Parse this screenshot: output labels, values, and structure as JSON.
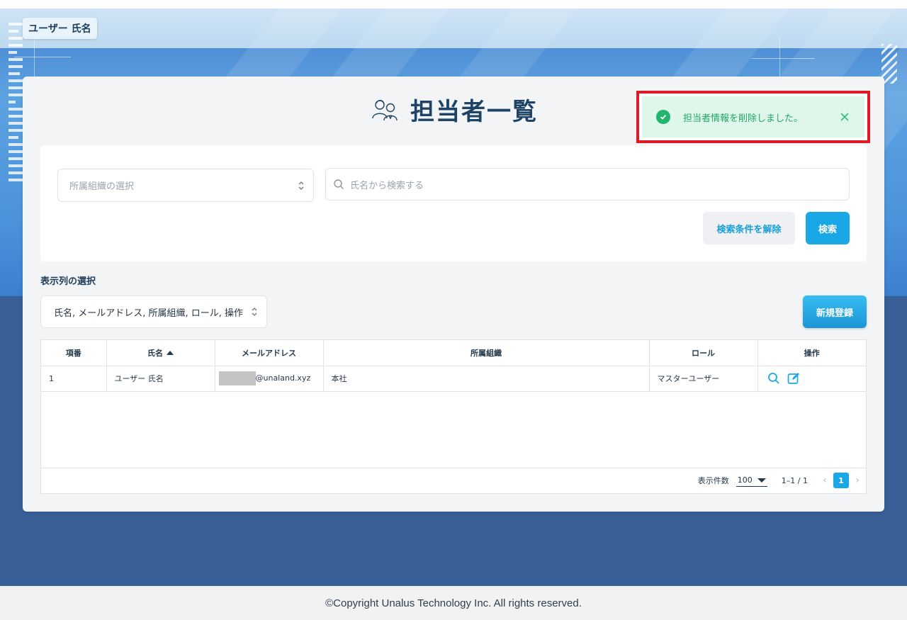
{
  "header": {
    "user_name": "ユーザー 氏名"
  },
  "page": {
    "title": "担当者一覧"
  },
  "toast": {
    "message": "担当者情報を削除しました。",
    "border_color": "#e01b24",
    "bg_color": "#dff6ea",
    "text_color": "#1fa865"
  },
  "search": {
    "org_select_placeholder": "所属組織の選択",
    "name_placeholder": "氏名から検索する",
    "clear_label": "検索条件を解除",
    "search_label": "検索"
  },
  "columns": {
    "label": "表示列の選択",
    "selected": "氏名, メールアドレス, 所属組織, ロール, 操作"
  },
  "new_button_label": "新規登録",
  "table": {
    "headers": [
      "項番",
      "氏名",
      "メールアドレス",
      "所属組織",
      "ロール",
      "操作"
    ],
    "sorted_column": "氏名",
    "sort_direction": "ascending",
    "rows": [
      {
        "index": "1",
        "name": "ユーザー 氏名",
        "email_domain": "@unaland.xyz",
        "org": "本社",
        "role": "マスターユーザー",
        "actions": [
          "search-icon",
          "edit-icon"
        ]
      }
    ]
  },
  "pagination": {
    "per_page_label": "表示件数",
    "per_page_value": "100",
    "range": "1–1 / 1",
    "current_page": "1"
  },
  "footer": {
    "copyright": "©Copyright Unalus Technology Inc. All rights reserved."
  },
  "colors": {
    "accent": "#1aa7e6",
    "title": "#1d4466",
    "bg_dark": "#386097"
  }
}
